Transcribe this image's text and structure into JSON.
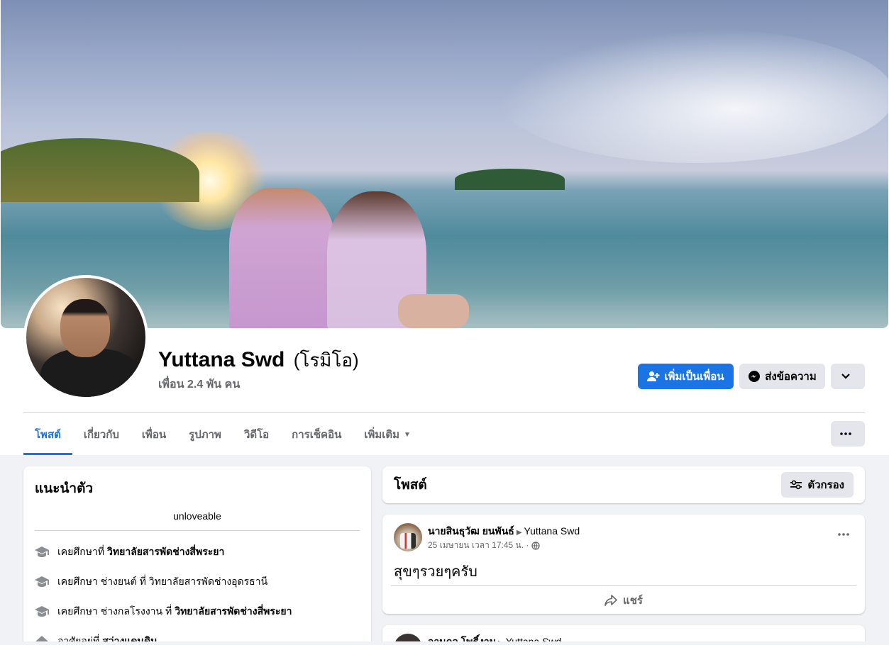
{
  "profile": {
    "name": "Yuttana Swd",
    "alt_name": "(โรมิโอ)",
    "friends": "เพื่อน 2.4 พัน คน"
  },
  "actions": {
    "add_friend": "เพิ่มเป็นเพื่อน",
    "message": "ส่งข้อความ"
  },
  "tabs": [
    {
      "label": "โพสต์"
    },
    {
      "label": "เกี่ยวกับ"
    },
    {
      "label": "เพื่อน"
    },
    {
      "label": "รูปภาพ"
    },
    {
      "label": "วิดีโอ"
    },
    {
      "label": "การเช็คอิน"
    },
    {
      "label": "เพิ่มเติม"
    }
  ],
  "intro": {
    "title": "แนะนำตัว",
    "bio": "unloveable",
    "items": [
      {
        "icon": "graduation-cap-icon",
        "prefix": "เคยศึกษาที่",
        "bold": "วิทยาลัยสารพัดช่างสี่พระยา"
      },
      {
        "icon": "graduation-cap-icon",
        "prefix": "เคยศึกษา ช่างยนต์ ที่ วิทยาลัยสารพัดช่างอุดรธานี",
        "bold": ""
      },
      {
        "icon": "graduation-cap-icon",
        "prefix": "เคยศึกษา ช่างกลโรงงาน ที่",
        "bold": "วิทยาลัยสารพัดช่างสี่พระยา"
      },
      {
        "icon": "home-icon",
        "prefix": "อาศัยอยู่ที่",
        "bold": "สว่างแดนดิน"
      }
    ]
  },
  "posts_header": {
    "title": "โพสต์",
    "filter": "ตัวกรอง"
  },
  "posts": [
    {
      "author": "นายสินธุวัฒ ยนพันธ์",
      "target": "Yuttana Swd",
      "time": "25 เมษายน เวลา 17:45 น. ·",
      "text": "สุขๆรวยๆครับ",
      "share": "แชร์"
    },
    {
      "author": "อานุกูล โพธิ์งาม",
      "target": "Yuttana Swd"
    }
  ],
  "colors": {
    "accent": "#1b74e4",
    "background": "#f0f2f5",
    "secondary_button": "#e4e6eb",
    "muted_text": "#65676b"
  }
}
